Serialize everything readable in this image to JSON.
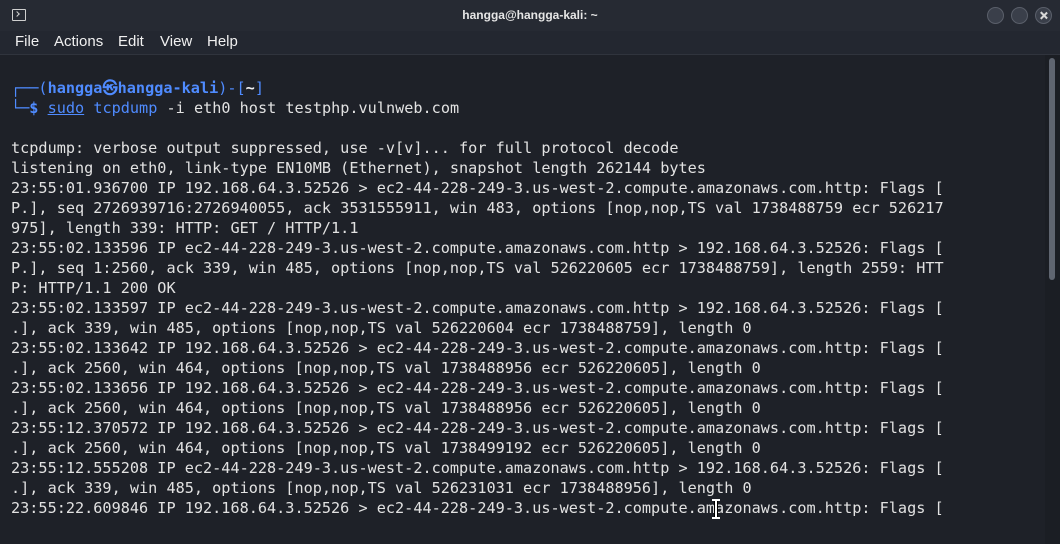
{
  "window": {
    "title": "hangga@hangga-kali: ~"
  },
  "menu": [
    "File",
    "Actions",
    "Edit",
    "View",
    "Help"
  ],
  "prompt": {
    "corner_top": "┌──(",
    "user": "hangga",
    "skull": "㉿",
    "host": "hangga-kali",
    "close_paren": ")-[",
    "cwd": "~",
    "close_bracket": "]",
    "corner_bottom": "└─",
    "symbol": "$",
    "sudo": "sudo",
    "command": "tcpdump",
    "args": "-i eth0 host testphp.vulnweb.com"
  },
  "output": [
    "tcpdump: verbose output suppressed, use -v[v]... for full protocol decode",
    "listening on eth0, link-type EN10MB (Ethernet), snapshot length 262144 bytes",
    "23:55:01.936700 IP 192.168.64.3.52526 > ec2-44-228-249-3.us-west-2.compute.amazonaws.com.http: Flags [",
    "P.], seq 2726939716:2726940055, ack 3531555911, win 483, options [nop,nop,TS val 1738488759 ecr 526217",
    "975], length 339: HTTP: GET / HTTP/1.1",
    "23:55:02.133596 IP ec2-44-228-249-3.us-west-2.compute.amazonaws.com.http > 192.168.64.3.52526: Flags [",
    "P.], seq 1:2560, ack 339, win 485, options [nop,nop,TS val 526220605 ecr 1738488759], length 2559: HTT",
    "P: HTTP/1.1 200 OK",
    "23:55:02.133597 IP ec2-44-228-249-3.us-west-2.compute.amazonaws.com.http > 192.168.64.3.52526: Flags [",
    ".], ack 339, win 485, options [nop,nop,TS val 526220604 ecr 1738488759], length 0",
    "23:55:02.133642 IP 192.168.64.3.52526 > ec2-44-228-249-3.us-west-2.compute.amazonaws.com.http: Flags [",
    ".], ack 2560, win 464, options [nop,nop,TS val 1738488956 ecr 526220605], length 0",
    "23:55:02.133656 IP 192.168.64.3.52526 > ec2-44-228-249-3.us-west-2.compute.amazonaws.com.http: Flags [",
    ".], ack 2560, win 464, options [nop,nop,TS val 1738488956 ecr 526220605], length 0",
    "23:55:12.370572 IP 192.168.64.3.52526 > ec2-44-228-249-3.us-west-2.compute.amazonaws.com.http: Flags [",
    ".], ack 2560, win 464, options [nop,nop,TS val 1738499192 ecr 526220605], length 0",
    "23:55:12.555208 IP ec2-44-228-249-3.us-west-2.compute.amazonaws.com.http > 192.168.64.3.52526: Flags [",
    ".], ack 339, win 485, options [nop,nop,TS val 526231031 ecr 1738488956], length 0",
    "23:55:22.609846 IP 192.168.64.3.52526 > ec2-44-228-249-3.us-west-2.compute.amazonaws.com.http: Flags ["
  ],
  "colors": {
    "terminal_bg": "#1e2128",
    "prompt_blue": "#4f8bff",
    "text": "#e2e2e2"
  }
}
